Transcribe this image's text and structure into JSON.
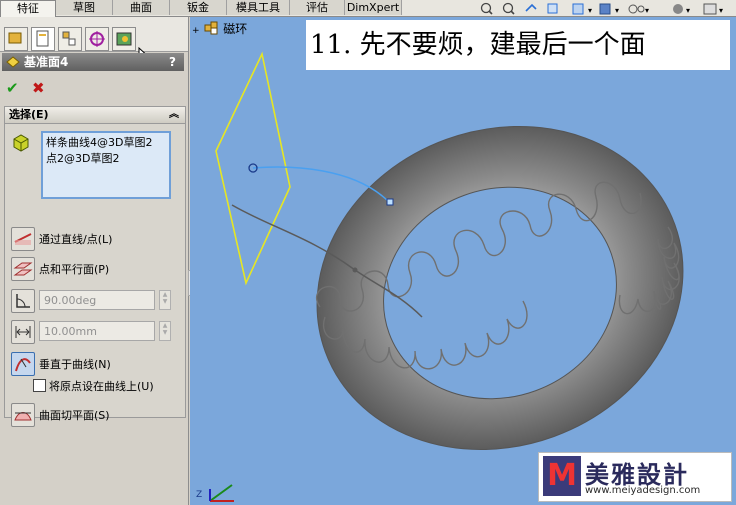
{
  "tabs": [
    {
      "label": "特征",
      "active": true
    },
    {
      "label": "草图"
    },
    {
      "label": "曲面"
    },
    {
      "label": "钣金"
    },
    {
      "label": "模具工具"
    },
    {
      "label": "评估"
    },
    {
      "label": "DimXpert"
    }
  ],
  "panel": {
    "title": "基准面4",
    "help": "?",
    "ok": "✔",
    "cancel": "✖",
    "group_label": "选择(E)",
    "collapse_icon": "chevron-up-icon",
    "selections": [
      "样条曲线4@3D草图2",
      "点2@3D草图2"
    ],
    "options": {
      "through_line": "通过直线/点(L)",
      "point_parallel": "点和平行面(P)",
      "angle_value": "90.00deg",
      "offset_value": "10.00mm",
      "normal_to_curve": "垂直于曲线(N)",
      "origin_on_curve": "将原点设在曲线上(U)",
      "surface_tangent": "曲面切平面(S)"
    }
  },
  "viewport": {
    "tree_label": "磁环",
    "caption": "11. 先不要烦，建最后一个面",
    "triad_z": "Z"
  },
  "watermark": {
    "logo_text": "美雅設計",
    "url": "www.meiyadesign.com"
  },
  "colors": {
    "viewport_bg": "#7ba7db",
    "plane": "#e6e623",
    "torus": "#9a9a9a",
    "accent": "#2a6fd6"
  }
}
